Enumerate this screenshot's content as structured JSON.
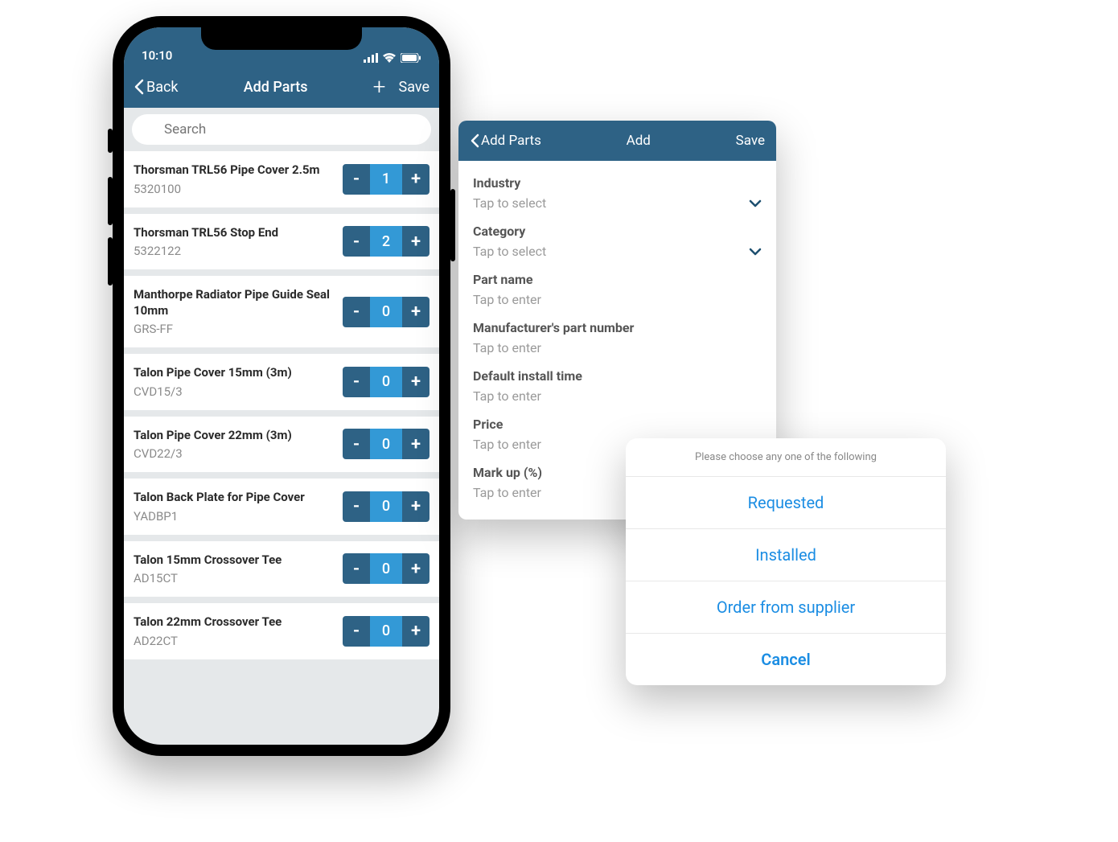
{
  "phone": {
    "status": {
      "time": "10:10"
    },
    "nav": {
      "back": "Back",
      "title": "Add Parts",
      "save": "Save"
    },
    "search": {
      "placeholder": "Search"
    },
    "parts": [
      {
        "name": "Thorsman TRL56 Pipe Cover 2.5m",
        "code": "5320100",
        "qty": "1"
      },
      {
        "name": "Thorsman TRL56 Stop End",
        "code": "5322122",
        "qty": "2"
      },
      {
        "name": "Manthorpe Radiator Pipe Guide Seal 10mm",
        "code": "GRS-FF",
        "qty": "0"
      },
      {
        "name": "Talon Pipe Cover 15mm (3m)",
        "code": "CVD15/3",
        "qty": "0"
      },
      {
        "name": "Talon Pipe Cover 22mm (3m)",
        "code": "CVD22/3",
        "qty": "0"
      },
      {
        "name": "Talon Back Plate for Pipe Cover",
        "code": "YADBP1",
        "qty": "0"
      },
      {
        "name": "Talon 15mm Crossover Tee",
        "code": "AD15CT",
        "qty": "0"
      },
      {
        "name": "Talon 22mm Crossover Tee",
        "code": "AD22CT",
        "qty": "0"
      }
    ]
  },
  "addPanel": {
    "nav": {
      "back": "Add Parts",
      "title": "Add",
      "save": "Save"
    },
    "fields": {
      "industry": {
        "label": "Industry",
        "placeholder": "Tap to select"
      },
      "category": {
        "label": "Category",
        "placeholder": "Tap to select"
      },
      "partName": {
        "label": "Part name",
        "placeholder": "Tap to enter"
      },
      "mfrPart": {
        "label": "Manufacturer's part number",
        "placeholder": "Tap to enter"
      },
      "installTime": {
        "label": "Default install time",
        "placeholder": "Tap to enter"
      },
      "price": {
        "label": "Price",
        "placeholder": "Tap to enter"
      },
      "markup": {
        "label": "Mark up (%)",
        "placeholder": "Tap to enter"
      }
    }
  },
  "actionSheet": {
    "header": "Please choose any one of the following",
    "options": {
      "requested": "Requested",
      "installed": "Installed",
      "order": "Order from supplier",
      "cancel": "Cancel"
    }
  }
}
